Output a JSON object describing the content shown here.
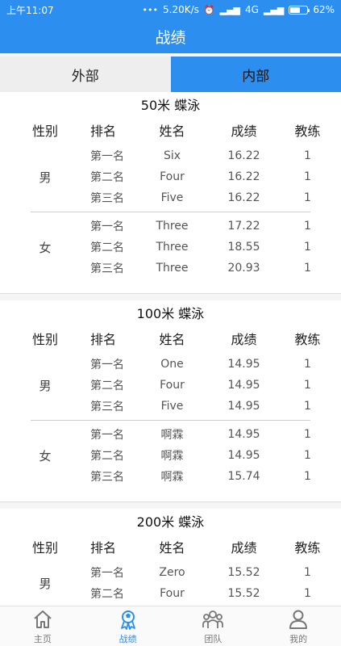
{
  "status": {
    "time": "上午11:07",
    "speed": "5.20K/s",
    "network": "4G",
    "battery": "62%",
    "battery_level": 0.62
  },
  "header": {
    "title": "战绩"
  },
  "tabs": [
    {
      "label": "外部",
      "active": false
    },
    {
      "label": "内部",
      "active": true
    }
  ],
  "columns": {
    "gender": "性别",
    "rank": "排名",
    "name": "姓名",
    "score": "成绩",
    "coach": "教练"
  },
  "sections": [
    {
      "title": "50米  蝶泳",
      "groups": [
        {
          "gender": "男",
          "rows": [
            {
              "rank": "第一名",
              "name": "Six",
              "score": "16.22",
              "coach": "1"
            },
            {
              "rank": "第二名",
              "name": "Four",
              "score": "16.22",
              "coach": "1"
            },
            {
              "rank": "第三名",
              "name": "Five",
              "score": "16.22",
              "coach": "1"
            }
          ]
        },
        {
          "gender": "女",
          "rows": [
            {
              "rank": "第一名",
              "name": "Three",
              "score": "17.22",
              "coach": "1"
            },
            {
              "rank": "第二名",
              "name": "Three",
              "score": "18.55",
              "coach": "1"
            },
            {
              "rank": "第三名",
              "name": "Three",
              "score": "20.93",
              "coach": "1"
            }
          ]
        }
      ]
    },
    {
      "title": "100米  蝶泳",
      "groups": [
        {
          "gender": "男",
          "rows": [
            {
              "rank": "第一名",
              "name": "One",
              "score": "14.95",
              "coach": "1"
            },
            {
              "rank": "第二名",
              "name": "Four",
              "score": "14.95",
              "coach": "1"
            },
            {
              "rank": "第三名",
              "name": "Five",
              "score": "14.95",
              "coach": "1"
            }
          ]
        },
        {
          "gender": "女",
          "rows": [
            {
              "rank": "第一名",
              "name": "啊霖",
              "score": "14.95",
              "coach": "1"
            },
            {
              "rank": "第二名",
              "name": "啊霖",
              "score": "14.95",
              "coach": "1"
            },
            {
              "rank": "第三名",
              "name": "啊霖",
              "score": "15.74",
              "coach": "1"
            }
          ]
        }
      ]
    },
    {
      "title": "200米  蝶泳",
      "groups": [
        {
          "gender": "男",
          "rows": [
            {
              "rank": "第一名",
              "name": "Zero",
              "score": "15.52",
              "coach": "1"
            },
            {
              "rank": "第二名",
              "name": "Four",
              "score": "15.52",
              "coach": "1"
            }
          ]
        }
      ]
    }
  ],
  "nav": [
    {
      "label": "主页",
      "icon": "home-icon",
      "active": false
    },
    {
      "label": "战绩",
      "icon": "medal-icon",
      "active": true
    },
    {
      "label": "团队",
      "icon": "team-icon",
      "active": false
    },
    {
      "label": "我的",
      "icon": "user-icon",
      "active": false
    }
  ],
  "colors": {
    "primary": "#2c8ff0",
    "tab_inactive": "#eeeeee"
  }
}
